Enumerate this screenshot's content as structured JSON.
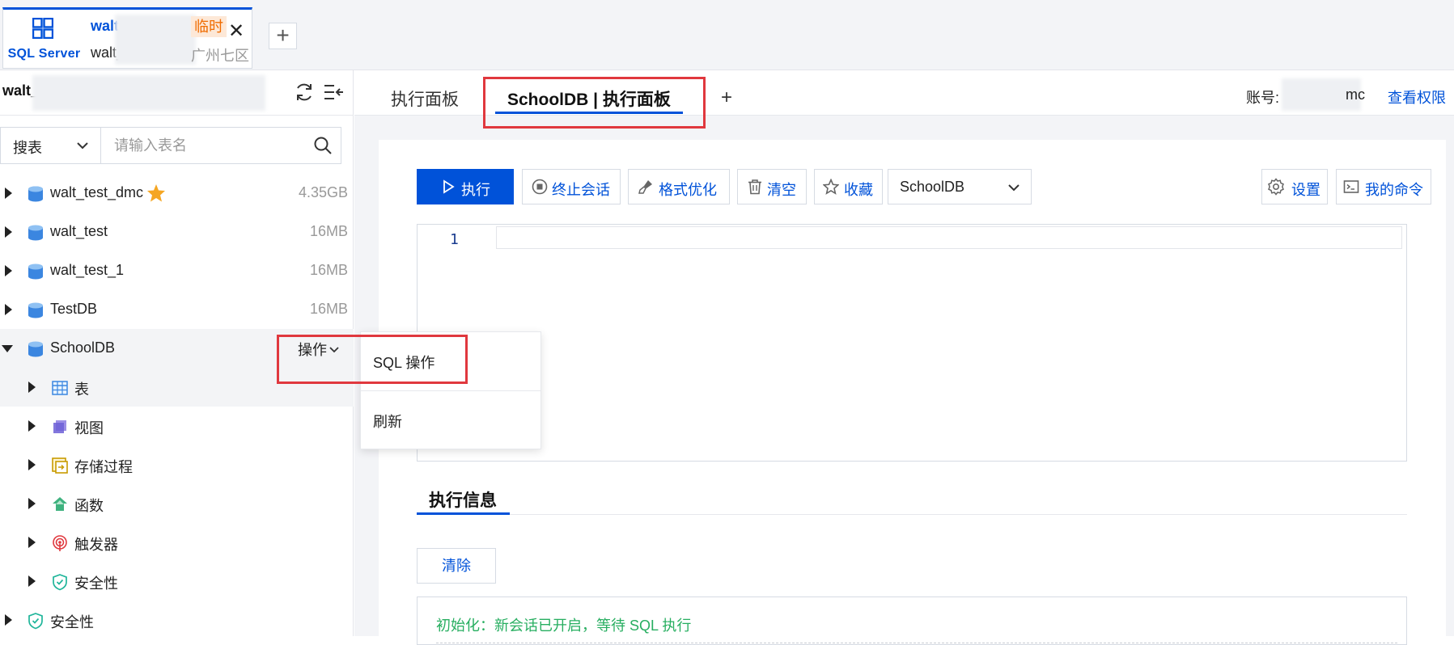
{
  "instance_tab": {
    "app_name": "SQL Server",
    "name": "walt",
    "badge": "临时",
    "sub": "walt_",
    "region": "广州七区",
    "close": "✕"
  },
  "add_instance": "+",
  "sidebar": {
    "instance_name": "walt_",
    "search_type": "搜表",
    "search_placeholder": "请输入表名",
    "databases": [
      {
        "name": "walt_test_dmc",
        "size": "4.35GB"
      },
      {
        "name": "walt_test",
        "size": "16MB"
      },
      {
        "name": "walt_test_1",
        "size": "16MB"
      },
      {
        "name": "TestDB",
        "size": "16MB"
      },
      {
        "name": "SchoolDB",
        "size": ""
      }
    ],
    "schooldb_op": "操作",
    "children": [
      "表",
      "视图",
      "存储过程",
      "函数",
      "触发器",
      "安全性"
    ],
    "security_root": "安全性"
  },
  "dropdown": {
    "items": [
      "SQL 操作",
      "刷新"
    ]
  },
  "tabs": {
    "items": [
      "执行面板",
      "SchoolDB | 执行面板"
    ],
    "add": "+"
  },
  "account": {
    "label": "账号:",
    "suffix": "mc",
    "permission_link": "查看权限"
  },
  "toolbar": {
    "run": "执行",
    "kill": "终止会话",
    "format": "格式优化",
    "clear": "清空",
    "favorite": "收藏",
    "database": "SchoolDB",
    "settings": "设置",
    "my_commands": "我的命令"
  },
  "editor": {
    "line_number": "1"
  },
  "info": {
    "title": "执行信息",
    "clear": "清除",
    "log": "初始化：新会话已开启，等待 SQL 执行"
  },
  "colors": {
    "primary": "#0052d9",
    "highlight": "#e0383e",
    "success": "#27ae60",
    "temp_badge": "#f06c00"
  }
}
